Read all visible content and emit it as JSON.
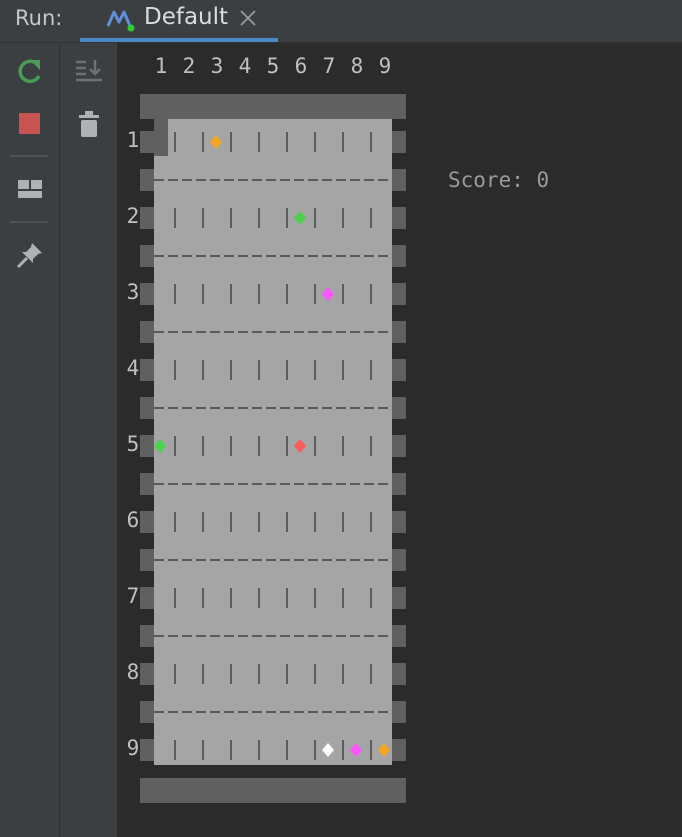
{
  "run_panel": {
    "label": "Run:",
    "tab": {
      "name": "Default"
    }
  },
  "toolbar": {
    "buttons": [
      {
        "name": "rerun-icon",
        "color": "#499c54"
      },
      {
        "name": "stop-icon",
        "color": "#c75450"
      },
      {
        "name": "layout-icon",
        "color": "#afb1b3"
      },
      {
        "name": "pin-icon",
        "color": "#afb1b3"
      }
    ],
    "secondary": [
      {
        "name": "scroll-to-end-icon"
      },
      {
        "name": "trash-icon"
      }
    ]
  },
  "game": {
    "columns": [
      "1",
      "2",
      "3",
      "4",
      "5",
      "6",
      "7",
      "8",
      "9"
    ],
    "rows": [
      "1",
      "2",
      "3",
      "4",
      "5",
      "6",
      "7",
      "8",
      "9"
    ],
    "score_text": "Score: 0",
    "gems": [
      {
        "row": 1,
        "col": 3,
        "color": "#f5a623"
      },
      {
        "row": 2,
        "col": 6,
        "color": "#4cd14c"
      },
      {
        "row": 3,
        "col": 7,
        "color": "#ff55ff"
      },
      {
        "row": 5,
        "col": 1,
        "color": "#4cd14c"
      },
      {
        "row": 5,
        "col": 6,
        "color": "#ff5c5c"
      },
      {
        "row": 9,
        "col": 7,
        "color": "#ffffff"
      },
      {
        "row": 9,
        "col": 8,
        "color": "#ff55ff"
      },
      {
        "row": 9,
        "col": 9,
        "color": "#f5a623"
      }
    ]
  }
}
